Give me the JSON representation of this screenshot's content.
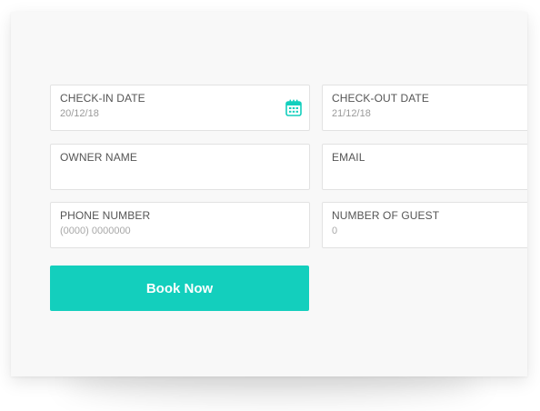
{
  "form": {
    "checkin": {
      "label": "CHECK-IN DATE",
      "value": "20/12/18",
      "icon": "calendar-icon"
    },
    "checkout": {
      "label": "CHECK-OUT DATE",
      "value": "21/12/18"
    },
    "owner": {
      "label": "OWNER NAME",
      "value": ""
    },
    "email": {
      "label": "EMAIL",
      "value": ""
    },
    "phone": {
      "label": "PHONE NUMBER",
      "placeholder": "(0000) 0000000"
    },
    "guests": {
      "label": "NUMBER OF GUEST",
      "placeholder": "0"
    },
    "submit_label": "Book Now"
  },
  "colors": {
    "accent": "#13cfbd",
    "card_background": "#f8f8f8",
    "field_border": "#e2e2e2"
  }
}
